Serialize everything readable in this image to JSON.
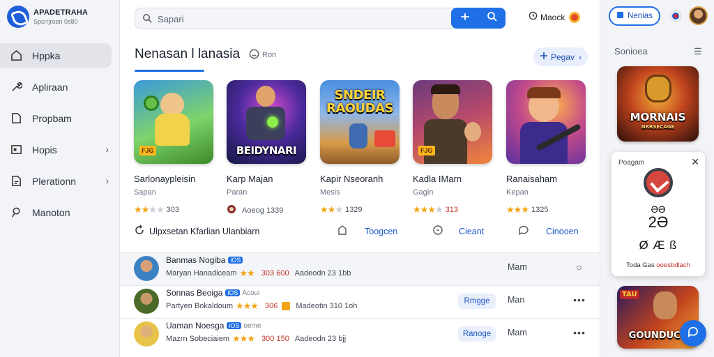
{
  "brand": {
    "title": "APADETRAHA",
    "subtitle": "Spcrrjroen 0s80"
  },
  "sidebar": {
    "items": [
      {
        "label": "Hppka",
        "icon": "home-icon"
      },
      {
        "label": "Apliraan",
        "icon": "wrench-icon"
      },
      {
        "label": "Propbam",
        "icon": "document-icon"
      },
      {
        "label": "Hopis",
        "icon": "window-icon"
      },
      {
        "label": "Plerationn",
        "icon": "report-icon"
      },
      {
        "label": "Manoton",
        "icon": "user-search-icon"
      }
    ]
  },
  "search": {
    "placeholder": "Sapari"
  },
  "topbar": {
    "label": "Maock"
  },
  "main": {
    "title": "Nenasan l lanasia",
    "title_badge": "Ron",
    "view_button": "Pegav"
  },
  "cards": [
    {
      "title": "Sarlonaypleisin",
      "subtitle": "Sapan",
      "rating_stars": 2,
      "rating_text": "303",
      "art_label": "FJG",
      "colors": [
        "#3a9ad9",
        "#5fc24a"
      ]
    },
    {
      "title": "Karp Majan",
      "subtitle": "Paran",
      "rating_stars": 0,
      "rating_text": "Aoeog 1339",
      "art_label": "BEIDYNARI",
      "colors": [
        "#1b1d5c",
        "#b02fb4"
      ]
    },
    {
      "title": "Kapir Nseoranh",
      "subtitle": "Mesis",
      "rating_stars": 2,
      "rating_text": "1329",
      "art_label": "SNDEIR RAOUDAS",
      "colors": [
        "#4a8fe0",
        "#f0a33a"
      ]
    },
    {
      "title": "Kadla IMarn",
      "subtitle": "Gagin",
      "rating_stars": 3,
      "rating_text": "313",
      "art_label": "FJG",
      "colors": [
        "#6b3a7e",
        "#f06a3c"
      ]
    },
    {
      "title": "Ranaisaham",
      "subtitle": "Kepan",
      "rating_stars": 3,
      "rating_text": "1325",
      "art_label": "",
      "colors": [
        "#7a2fc0",
        "#ff8c3a"
      ]
    }
  ],
  "actions": [
    {
      "label": "Ulpxsetan Kfarlian Ulanbiarn",
      "icon": "refresh-icon",
      "style": "dark"
    },
    {
      "label": "Toogcen",
      "icon": "bookmark-icon",
      "style": "blue"
    },
    {
      "label": "Cieant",
      "icon": "clock-icon",
      "style": "blue"
    },
    {
      "label": "Cinooen",
      "icon": "comment-icon",
      "style": "blue"
    }
  ],
  "rows": [
    {
      "title": "Banmas Nogiba",
      "badge": "iOS",
      "badge_text": "",
      "meta_name": "Maryan Hanadiceam",
      "stars": "★★",
      "num": "303 600",
      "extra": "Aadeodn 23 1bb",
      "action": "",
      "status": "Mam",
      "menu": "○"
    },
    {
      "title": "Sonnas Beoiga",
      "badge": "iOS",
      "badge_text": "Acoui",
      "meta_name": "Partyen Bokaldoum",
      "stars": "★★★",
      "num": "306",
      "extra": "Madeotin 310 1oh",
      "action": "Rmgge",
      "status": "Man",
      "menu": "•••"
    },
    {
      "title": "Uaman Noesga",
      "badge": "iOS",
      "badge_text": "oeme",
      "meta_name": "Mazrn Sobeciaiem",
      "stars": "★★★",
      "num": "300 150",
      "extra": "Aadeodn 23 bjj",
      "action": "Ranoge",
      "status": "Mam",
      "menu": "•••"
    }
  ],
  "right_panel": {
    "new_button": "Nenias",
    "title": "Sonioea",
    "art1_label": "MORNAIS",
    "art1_sub": "NRRSECAGE",
    "popup": {
      "title": "Poagam",
      "line1": "ƏƏ",
      "line2": "2Ə",
      "line3": "Ø Æ ß",
      "foot_prefix": "Toda Gas",
      "foot_red": "ooesbdlach"
    },
    "art2_label": "GOUNDUCS",
    "art2_sub": "TAU"
  },
  "colors": {
    "accent": "#1f6fe6",
    "star": "#f2a311",
    "sidebar_bg": "#f3f4f7"
  }
}
